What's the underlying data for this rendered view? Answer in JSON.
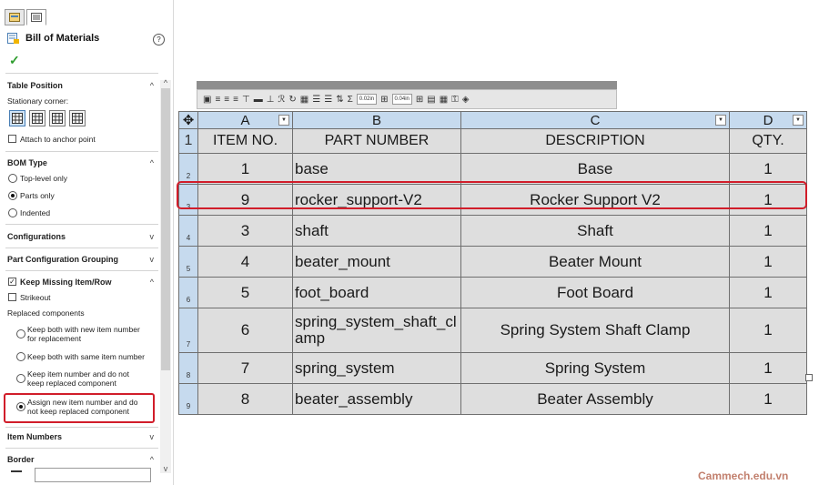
{
  "panel": {
    "title": "Bill of Materials",
    "help_icon": "?",
    "ok_icon": "✓",
    "sections": {
      "table_position": {
        "title": "Table Position",
        "stationary_corner_label": "Stationary corner:",
        "attach_anchor_label": "Attach to anchor point"
      },
      "bom_type": {
        "title": "BOM Type",
        "options": [
          "Top-level only",
          "Parts only",
          "Indented"
        ],
        "selected": "Parts only"
      },
      "configurations": {
        "title": "Configurations"
      },
      "part_config_grouping": {
        "title": "Part Configuration Grouping"
      },
      "keep_missing": {
        "title": "Keep Missing Item/Row",
        "strikeout_label": "Strikeout",
        "replaced_label": "Replaced components",
        "options": [
          [
            "Keep both with new item number",
            "for replacement"
          ],
          [
            "Keep both with same item number"
          ],
          [
            "Keep item number and do not",
            "keep replaced component"
          ],
          [
            "Assign new item number and do",
            "not keep replaced component"
          ]
        ],
        "selected_index": 3
      },
      "item_numbers": {
        "title": "Item Numbers"
      },
      "border": {
        "title": "Border"
      }
    }
  },
  "toolbar": {
    "border_width_1": "0.02in",
    "border_width_2": "0.04in"
  },
  "bom": {
    "columns": [
      "A",
      "B",
      "C",
      "D"
    ],
    "header": [
      "ITEM NO.",
      "PART NUMBER",
      "DESCRIPTION",
      "QTY."
    ],
    "rows": [
      {
        "num": "2",
        "item": "1",
        "part": "base",
        "desc": "Base",
        "qty": "1"
      },
      {
        "num": "3",
        "item": "9",
        "part": "rocker_support-V2",
        "desc": "Rocker Support V2",
        "qty": "1"
      },
      {
        "num": "4",
        "item": "3",
        "part": "shaft",
        "desc": "Shaft",
        "qty": "1"
      },
      {
        "num": "5",
        "item": "4",
        "part": "beater_mount",
        "desc": "Beater Mount",
        "qty": "1"
      },
      {
        "num": "6",
        "item": "5",
        "part": "foot_board",
        "desc": "Foot Board",
        "qty": "1"
      },
      {
        "num": "7",
        "item": "6",
        "part": "spring_system_shaft_clamp",
        "desc": "Spring System Shaft Clamp",
        "qty": "1"
      },
      {
        "num": "8",
        "item": "7",
        "part": "spring_system",
        "desc": "Spring System",
        "qty": "1"
      },
      {
        "num": "9",
        "item": "8",
        "part": "beater_assembly",
        "desc": "Beater Assembly",
        "qty": "1"
      }
    ],
    "header_row_num": "1"
  },
  "watermark": "Cammech.edu.vn",
  "colors": {
    "highlight": "#d11d2a",
    "header_blue": "#c6daee",
    "cell_gray": "#dedede"
  }
}
